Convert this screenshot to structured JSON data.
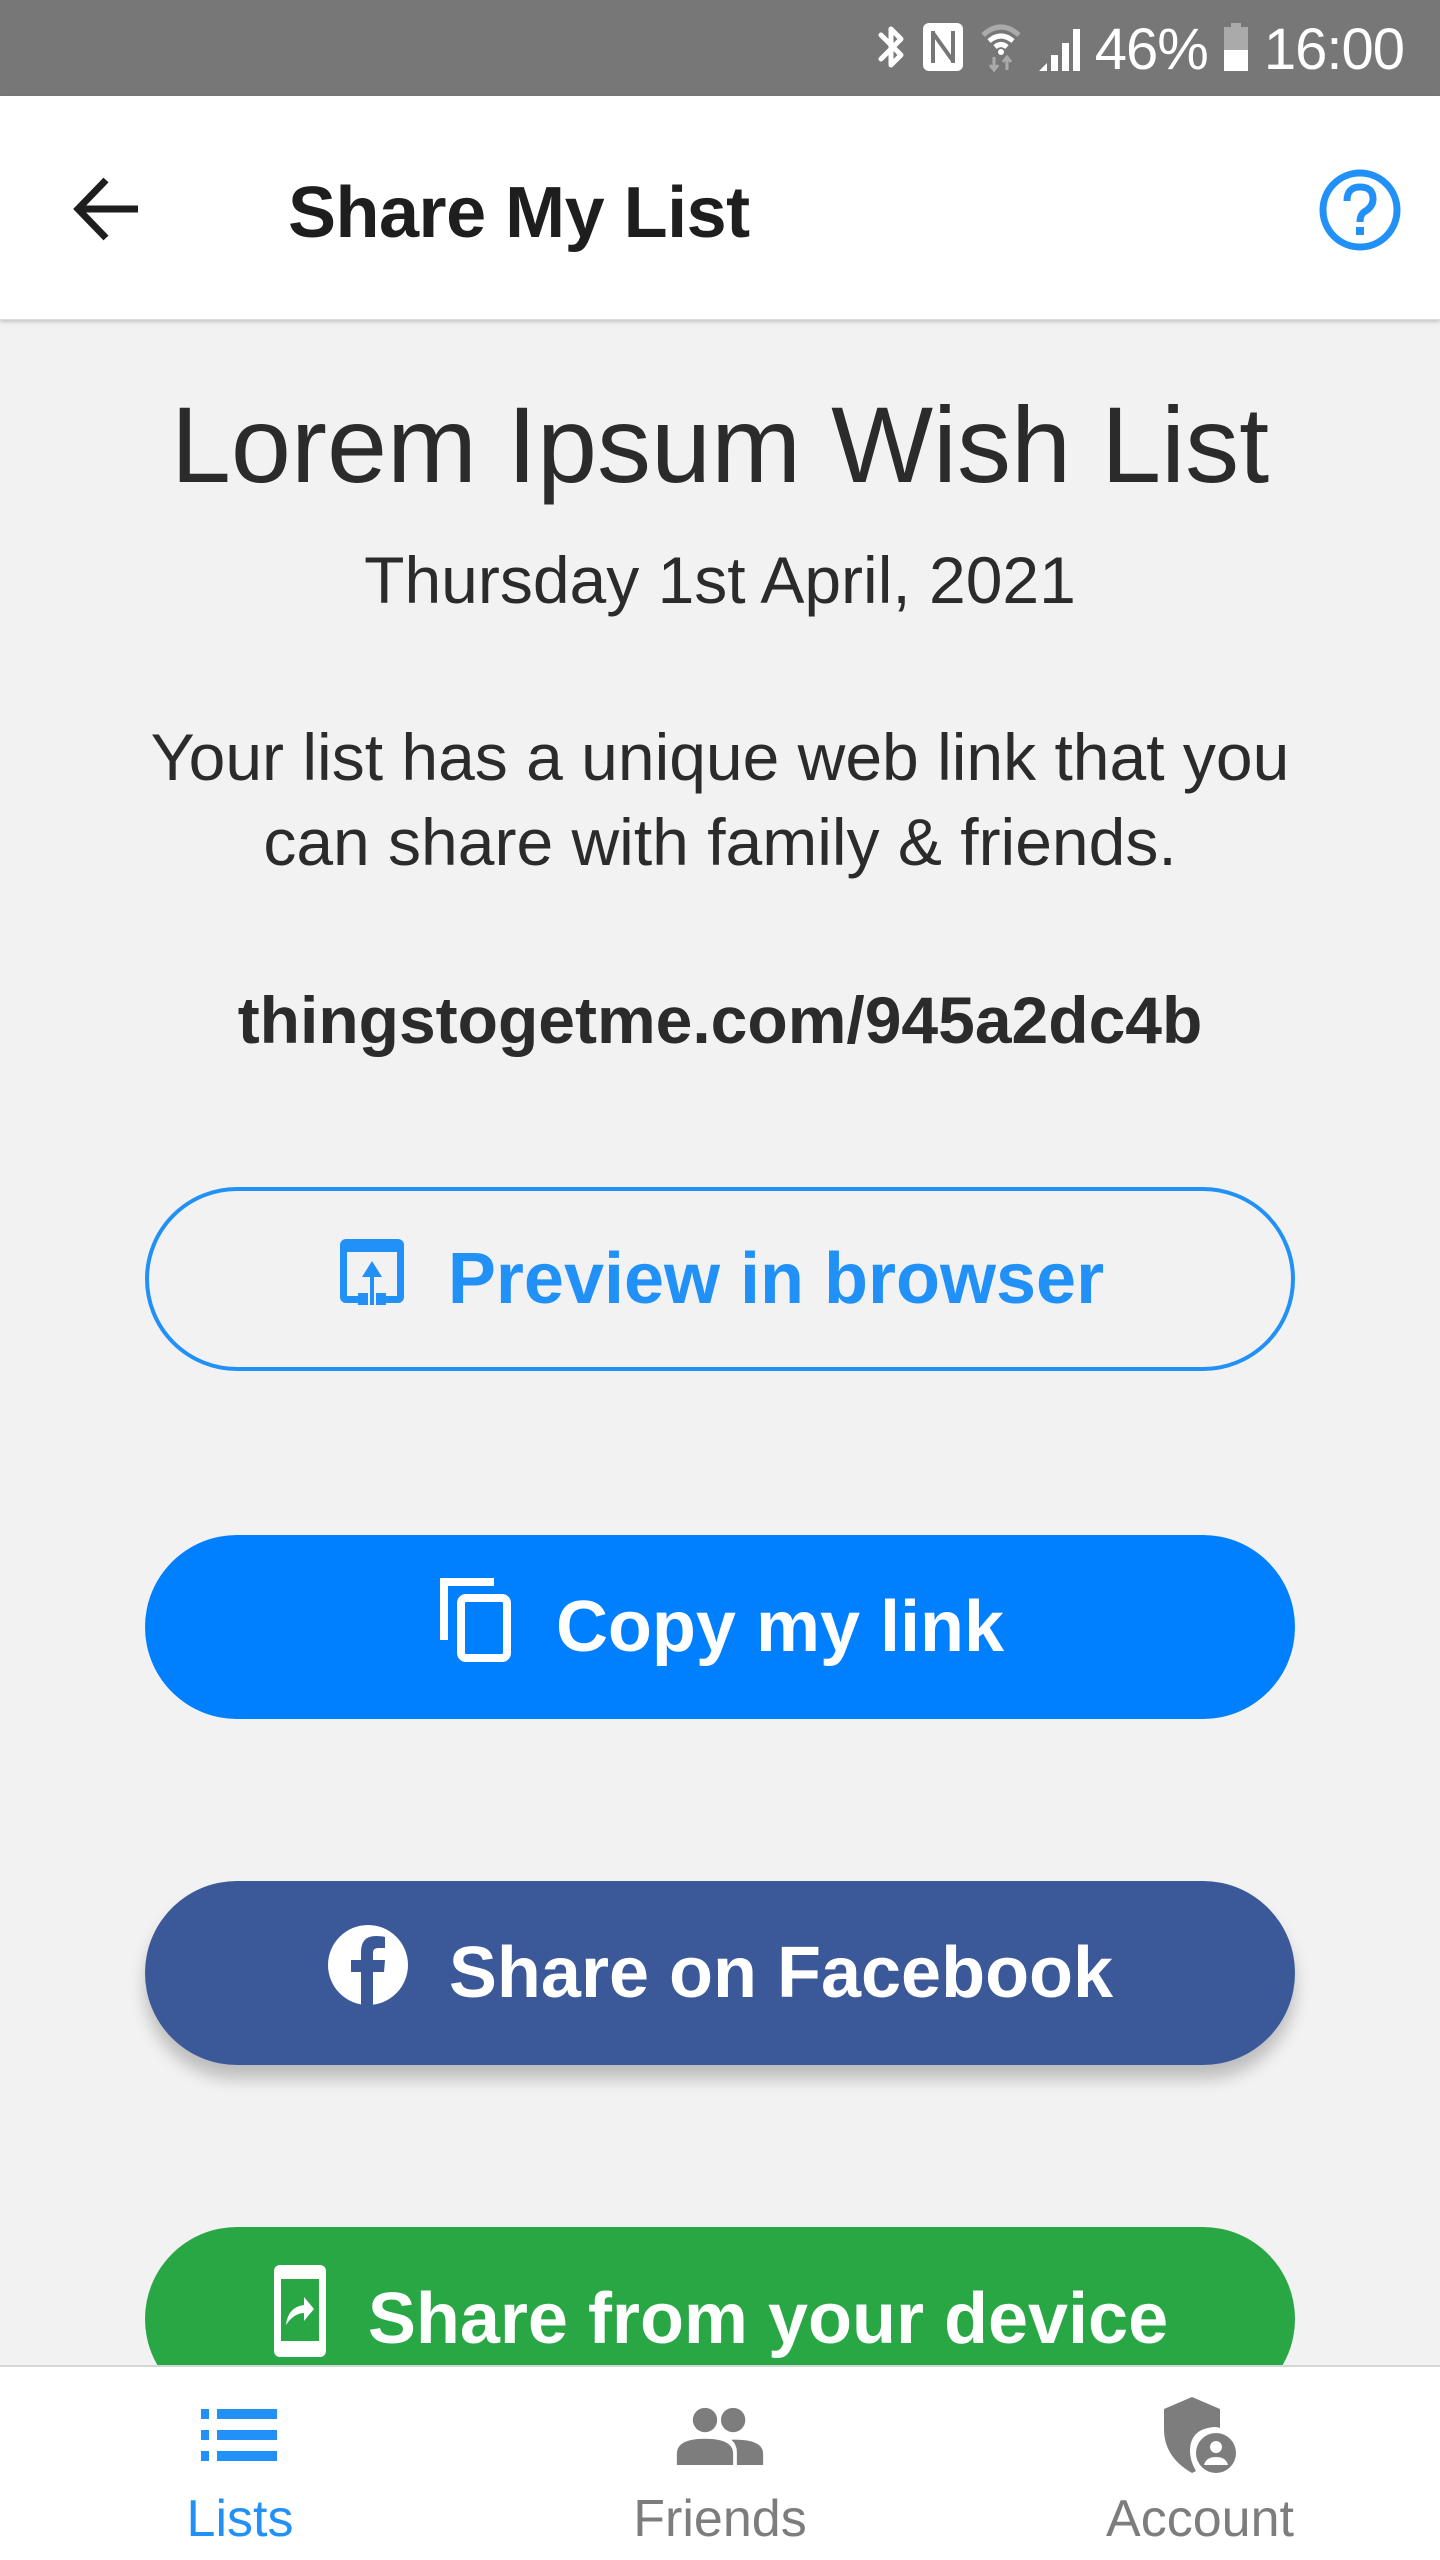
{
  "status_bar": {
    "icons": [
      "bluetooth-icon",
      "nfc-icon",
      "wifi-icon",
      "signal-icon",
      "battery-icon"
    ],
    "battery": "46%",
    "time": "16:00"
  },
  "app_bar": {
    "back_icon": "arrow-left-icon",
    "title": "Share My List",
    "help_icon": "help-circle-icon"
  },
  "list": {
    "title": "Lorem Ipsum Wish List",
    "date": "Thursday 1st April, 2021",
    "description": "Your list has a unique web link that you can share with family & friends.",
    "link": "thingstogetme.com/945a2dc4b"
  },
  "buttons": {
    "preview": {
      "label": "Preview in browser",
      "icon": "open-in-browser-icon",
      "color": "#2291f7"
    },
    "copy": {
      "label": "Copy my link",
      "icon": "copy-icon",
      "color": "#007fff"
    },
    "facebook": {
      "label": "Share on Facebook",
      "icon": "facebook-icon",
      "color": "#3b5998"
    },
    "device": {
      "label": "Share from your device",
      "icon": "mobile-share-icon",
      "color": "#29a745"
    }
  },
  "bottom_nav": {
    "active": "Lists",
    "items": [
      {
        "label": "Lists",
        "icon": "list-icon"
      },
      {
        "label": "Friends",
        "icon": "people-icon"
      },
      {
        "label": "Account",
        "icon": "shield-account-icon"
      }
    ]
  },
  "colors": {
    "accent": "#2291f7",
    "inactive": "#7d7d7d",
    "background": "#f2f2f2",
    "status_bar": "#777777"
  }
}
